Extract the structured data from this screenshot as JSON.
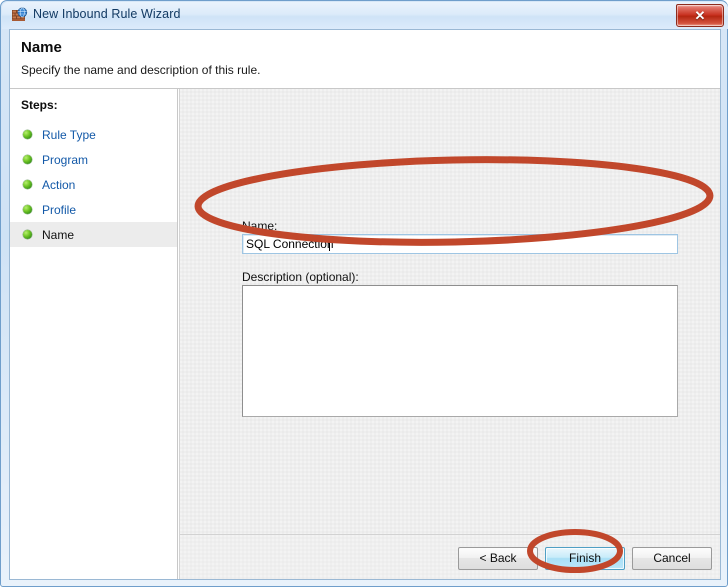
{
  "window": {
    "title": "New Inbound Rule Wizard",
    "icon": "firewall-globe-icon",
    "close_label": "✕"
  },
  "header": {
    "title": "Name",
    "subtitle": "Specify the name and description of this rule."
  },
  "sidebar": {
    "heading": "Steps:",
    "items": [
      {
        "label": "Rule Type",
        "current": false
      },
      {
        "label": "Program",
        "current": false
      },
      {
        "label": "Action",
        "current": false
      },
      {
        "label": "Profile",
        "current": false
      },
      {
        "label": "Name",
        "current": true
      }
    ]
  },
  "form": {
    "name_label": "Name:",
    "name_value": "SQL Connection",
    "name_placeholder": "",
    "description_label": "Description (optional):",
    "description_value": "",
    "description_placeholder": ""
  },
  "buttons": {
    "back": "< Back",
    "finish": "Finish",
    "cancel": "Cancel"
  },
  "annotations": {
    "color": "#c1472b",
    "ellipse_name_field": "highlight-name-field",
    "ellipse_finish_button": "highlight-finish-button"
  },
  "colors": {
    "titlebar_text": "#123a63",
    "step_link": "#1359a8",
    "close_button": "#c62d1b",
    "finish_button": "#a9dff6",
    "annotation_red": "#c1472b",
    "step_bullet_green": "#6fc424"
  }
}
